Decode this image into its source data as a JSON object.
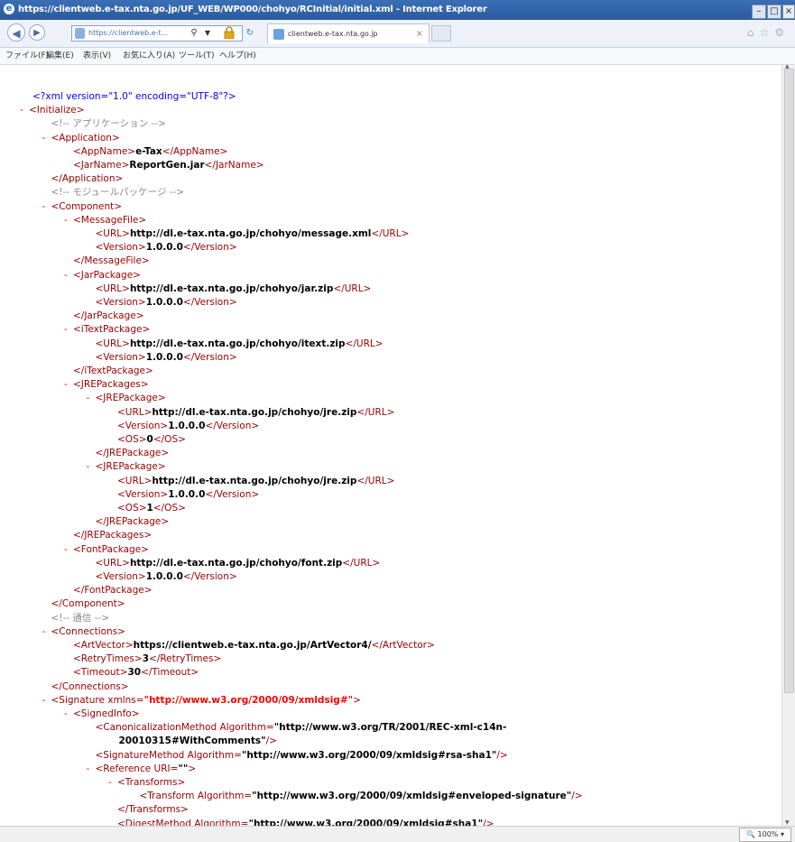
{
  "window": {
    "title": "https://clientweb.e-tax.nta.go.jp/UF_WEB/WP000/chohyo/RCInitial/initial.xml - Internet Explorer"
  },
  "navbar": {
    "address": "https://clientweb.e-t...",
    "tab_title": "clientweb.e-tax.nta.go.jp"
  },
  "menu": {
    "items": [
      "ファイル(F)",
      "編集(E)",
      "表示(V)",
      "お気に入り(A)",
      "ツール(T)",
      "ヘルプ(H)"
    ]
  },
  "xml": {
    "lines": [
      {
        "t": "pi",
        "s": "<?xml version=\"1.0\" encoding=\"UTF-8\"?>"
      },
      {
        "t": "open",
        "n": "Initialize"
      },
      {
        "t": "comment",
        "s": "<!-- アプリケーション -->"
      },
      {
        "t": "open",
        "n": "Application"
      },
      {
        "t": "leaf",
        "n": "AppName",
        "v": "e-Tax"
      },
      {
        "t": "leaf",
        "n": "JarName",
        "v": "ReportGen.jar"
      },
      {
        "t": "close",
        "n": "Application"
      },
      {
        "t": "comment",
        "s": "<!-- モジュールパッケージ -->"
      },
      {
        "t": "open",
        "n": "Component"
      },
      {
        "t": "open",
        "n": "MessageFile"
      },
      {
        "t": "leaf",
        "n": "URL",
        "v": "http://dl.e-tax.nta.go.jp/chohyo/message.xml"
      },
      {
        "t": "leaf",
        "n": "Version",
        "v": "1.0.0.0"
      },
      {
        "t": "close",
        "n": "MessageFile"
      },
      {
        "t": "open",
        "n": "JarPackage"
      },
      {
        "t": "leaf",
        "n": "URL",
        "v": "http://dl.e-tax.nta.go.jp/chohyo/jar.zip"
      },
      {
        "t": "leaf",
        "n": "Version",
        "v": "1.0.0.0"
      },
      {
        "t": "close",
        "n": "JarPackage"
      },
      {
        "t": "open",
        "n": "iTextPackage"
      },
      {
        "t": "leaf",
        "n": "URL",
        "v": "http://dl.e-tax.nta.go.jp/chohyo/itext.zip"
      },
      {
        "t": "leaf",
        "n": "Version",
        "v": "1.0.0.0"
      },
      {
        "t": "close",
        "n": "iTextPackage"
      },
      {
        "t": "open",
        "n": "JREPackages"
      },
      {
        "t": "open",
        "n": "JREPackage"
      },
      {
        "t": "leaf",
        "n": "URL",
        "v": "http://dl.e-tax.nta.go.jp/chohyo/jre.zip"
      },
      {
        "t": "leaf",
        "n": "Version",
        "v": "1.0.0.0"
      },
      {
        "t": "leaf",
        "n": "OS",
        "v": "0"
      },
      {
        "t": "close",
        "n": "JREPackage"
      },
      {
        "t": "open",
        "n": "JREPackage"
      },
      {
        "t": "leaf",
        "n": "URL",
        "v": "http://dl.e-tax.nta.go.jp/chohyo/jre.zip"
      },
      {
        "t": "leaf",
        "n": "Version",
        "v": "1.0.0.0"
      },
      {
        "t": "leaf",
        "n": "OS",
        "v": "1"
      },
      {
        "t": "close",
        "n": "JREPackage"
      },
      {
        "t": "close",
        "n": "JREPackages"
      },
      {
        "t": "open",
        "n": "FontPackage"
      },
      {
        "t": "leaf",
        "n": "URL",
        "v": "http://dl.e-tax.nta.go.jp/chohyo/font.zip"
      },
      {
        "t": "leaf",
        "n": "Version",
        "v": "1.0.0.0"
      },
      {
        "t": "close",
        "n": "FontPackage"
      },
      {
        "t": "close",
        "n": "Component"
      },
      {
        "t": "comment",
        "s": "<!-- 通信 -->"
      },
      {
        "t": "open",
        "n": "Connections"
      },
      {
        "t": "leaf",
        "n": "ArtVector",
        "v": "https://clientweb.e-tax.nta.go.jp/ArtVector4/"
      },
      {
        "t": "leaf",
        "n": "RetryTimes",
        "v": "3"
      },
      {
        "t": "leaf",
        "n": "Timeout",
        "v": "30"
      },
      {
        "t": "close",
        "n": "Connections"
      },
      {
        "t": "attr-open",
        "n": "Signature",
        "a": "xmlns",
        "v": "http://www.w3.org/2000/09/xmldsig#",
        "red": true
      },
      {
        "t": "open",
        "n": "SignedInfo"
      },
      {
        "t": "attr-self",
        "n": "CanonicalizationMethod",
        "a": "Algorithm",
        "v": "http://www.w3.org/TR/2001/REC-xml-c14n-"
      },
      {
        "t": "cont",
        "v": "20010315#WithComments",
        "end": "\"/>"
      },
      {
        "t": "attr-self",
        "n": "SignatureMethod",
        "a": "Algorithm",
        "v": "http://www.w3.org/2000/09/xmldsig#rsa-sha1",
        "end": "\"/>"
      },
      {
        "t": "attr-open",
        "n": "Reference",
        "a": "URI",
        "v": ""
      },
      {
        "t": "open",
        "n": "Transforms"
      },
      {
        "t": "attr-self",
        "n": "Transform",
        "a": "Algorithm",
        "v": "http://www.w3.org/2000/09/xmldsig#enveloped-signature",
        "end": "\"/>"
      },
      {
        "t": "close",
        "n": "Transforms"
      },
      {
        "t": "attr-self",
        "n": "DigestMethod",
        "a": "Algorithm",
        "v": "http://www.w3.org/2000/09/xmldsig#sha1",
        "end": "\"/>"
      }
    ]
  },
  "status": {
    "zoom": "100%"
  }
}
